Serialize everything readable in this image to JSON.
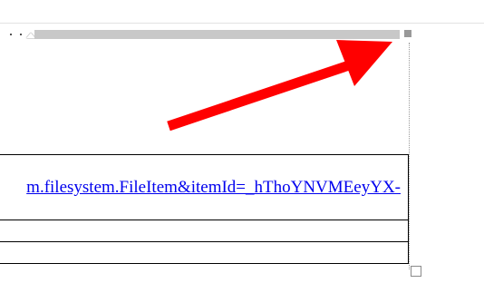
{
  "document": {
    "table": {
      "link_row": {
        "link_text": "m.filesystem.FileItem&itemId=_hThoYNVMEeyYX-"
      },
      "empty_rows": [
        {
          "text": ""
        },
        {
          "text": ""
        }
      ]
    }
  },
  "ruler": {
    "icon": "ruler-grip-icon"
  },
  "annotation": {
    "icon": "red-arrow-icon",
    "color": "#ff0000"
  }
}
